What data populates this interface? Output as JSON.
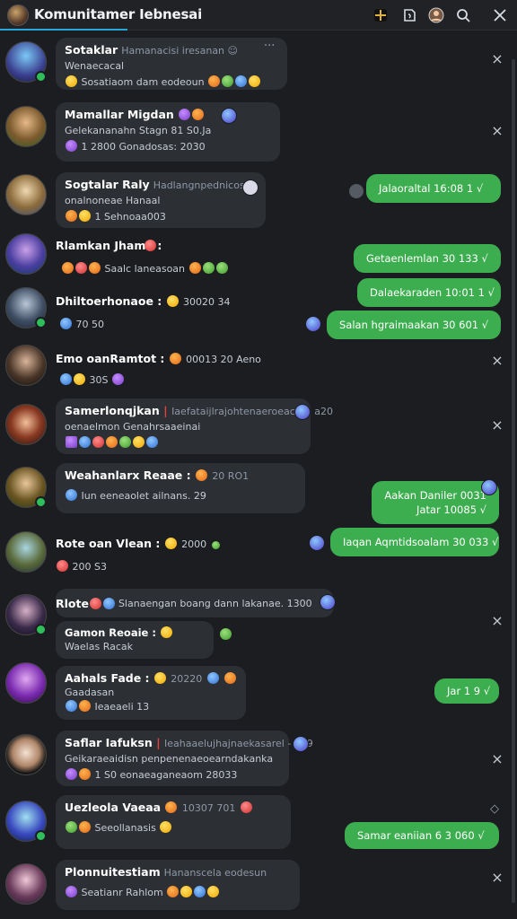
{
  "app": {
    "title": "Komunitamer Iebnesai",
    "icon": "app-avatar-icon",
    "toolbar_icons": [
      "cross-icon",
      "sticker-icon",
      "profile-avatar-icon",
      "search-icon",
      "close-icon"
    ]
  },
  "chats": [
    {
      "name": "Sotaklar",
      "sub": "Hamanacisi iresanan ☺",
      "line1": "Wenaecacal",
      "line2": "Sosatiaom    dam eodeoun",
      "has_more": true,
      "online": true
    },
    {
      "name": "Mamallar Migdan",
      "sub": "",
      "line1": "Gelekananahn Stagn 81 S0.Ja",
      "line2": "1   2800   Gonadosas: 2030",
      "online": false
    },
    {
      "name": "Sogtalar Raly",
      "sub": "Hadlangnpednicos :",
      "line1": "onalnoneae Hanaal",
      "line2": "1    Sehnoaa003",
      "online": false,
      "out": "Jalaoraltal 16:08 1 √"
    },
    {
      "name": "Rlamkan Jhamo :",
      "sub": "",
      "line1": "",
      "line2": "Saalc    laneasoan",
      "online": false,
      "out": "Getaenlemlan 30 133 √"
    },
    {
      "name": "Dhiltoerhonaoe :",
      "sub": "30020 34",
      "line1": "",
      "line2": "70  50",
      "online": true,
      "out": "Dalaekaraden 10:01 1 √",
      "out2": "Salan hgraimaakan 30 601 √"
    },
    {
      "name": "Emo oanRamtot :",
      "sub": "00013 20    Aeno",
      "line1": "",
      "line2": "30S",
      "online": false
    },
    {
      "name": "Samerlonqjkan",
      "sub": "Iaefataijlrajohtenaeroeac.0 - a20",
      "line1": "oenaelmon Genahrsaaeinai",
      "line2": "",
      "online": false
    },
    {
      "name": "Weahanlarx Reaae :",
      "sub": "20    RO1",
      "line1": "",
      "line2": "Iun eeneaolet ailnans. 29",
      "online": true,
      "out": "Aakan Daniler 0031\nJatar 10085 √"
    },
    {
      "name": "Rote oan Vlean :",
      "sub": "2000",
      "line1": "",
      "line2": "200    S3",
      "online": false,
      "out": "Iaqan Aqmtidsoalam 30 033 √"
    },
    {
      "name": "Rlote",
      "sub": "Slanaengan boang dann lakanae. 1300",
      "line1": "Gamon Reoaie :",
      "line2": "Waelas Racak",
      "online": true
    },
    {
      "name": "Aahals Fade :",
      "sub": "20220",
      "line1": "Gaadasan",
      "line2": "Ieaeaeli 13",
      "online": false,
      "out": "Jar 1 9 √"
    },
    {
      "name": "Saflar Iafuksn",
      "sub": "Ieahaaelujhajnaekasarel - 209",
      "line1": "Geikaraeaidisn penpenenaeoearndakanka",
      "line2": "1   S0    eonaeaganeaom    28033",
      "online": false
    },
    {
      "name": "Uezleola Vaeaa",
      "sub": "10307    701",
      "line1": "",
      "line2": "Seeollanasis",
      "online": true,
      "out": "Samar eaniian 6 3 060 √"
    },
    {
      "name": "Plonnuitestiam",
      "sub": "Hananscela eodesun",
      "line1": "",
      "line2": "Seatianr    Rahlom",
      "online": false
    }
  ]
}
